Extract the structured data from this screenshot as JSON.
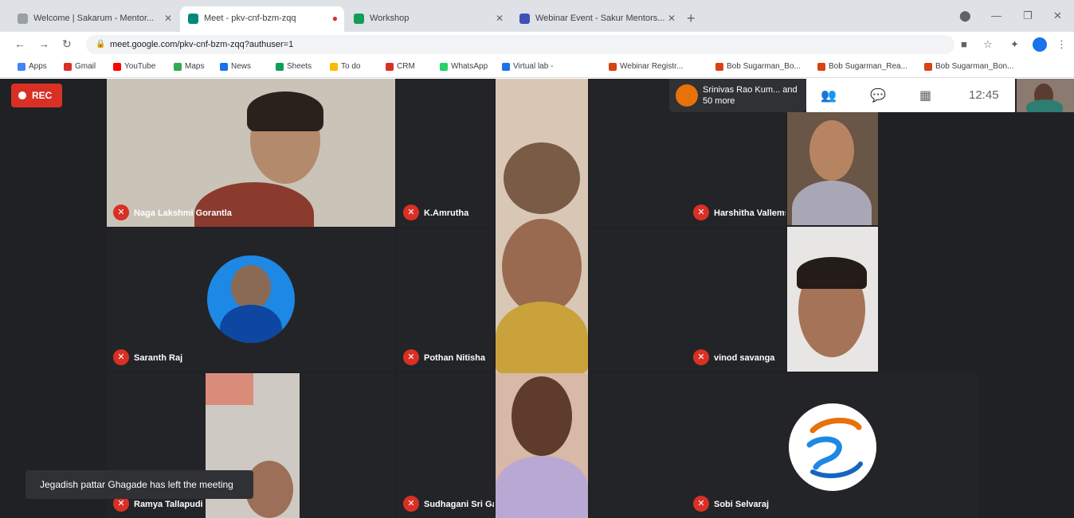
{
  "browser": {
    "tabs": [
      {
        "label": "Welcome | Sakarum - Mentor...",
        "color": "#5f6368"
      },
      {
        "label": "Meet - pkv-cnf-bzm-zqq",
        "color": "#00897b"
      },
      {
        "label": "Workshop",
        "color": "#0f9d58"
      },
      {
        "label": "Webinar Event - Sakur Mentors...",
        "color": "#3f51b5"
      }
    ],
    "url": "meet.google.com/pkv-cnf-bzm-zqq?authuser=1",
    "bookmarks": [
      {
        "label": "Apps",
        "color": "#4285f4"
      },
      {
        "label": "Gmail",
        "color": "#d93025"
      },
      {
        "label": "YouTube",
        "color": "#ff0000"
      },
      {
        "label": "Maps",
        "color": "#34a853"
      },
      {
        "label": "News",
        "color": "#1a73e8"
      },
      {
        "label": "Sheets",
        "color": "#0f9d58"
      },
      {
        "label": "To do",
        "color": "#fbbc04"
      },
      {
        "label": "CRM",
        "color": "#d93025"
      },
      {
        "label": "WhatsApp",
        "color": "#25d366"
      },
      {
        "label": "Virtual lab -",
        "color": "#1a73e8"
      },
      {
        "label": "Webinar Registr...",
        "color": "#d84315"
      },
      {
        "label": "Bob Sugarman_Bo...",
        "color": "#d84315"
      },
      {
        "label": "Bob Sugarman_Rea...",
        "color": "#d84315"
      },
      {
        "label": "Bob Sugarman_Bon...",
        "color": "#d84315"
      }
    ]
  },
  "meet": {
    "rec_label": "REC",
    "notification": "Srinivas Rao Kum... and 50 more",
    "clock": "12:45",
    "toast": "Jegadish pattar Ghagade has left the meeting",
    "participants": [
      {
        "name": "Naga Lakshmi Gorantla"
      },
      {
        "name": "K.Amrutha"
      },
      {
        "name": "Harshitha Vallemsetty"
      },
      {
        "name": "Saranth Raj"
      },
      {
        "name": "Pothan Nitisha"
      },
      {
        "name": "vinod savanga"
      },
      {
        "name": "Ramya Tallapudi"
      },
      {
        "name": "Sudhagani Sri Ganesh"
      },
      {
        "name": "Sobi Selvaraj"
      }
    ]
  }
}
